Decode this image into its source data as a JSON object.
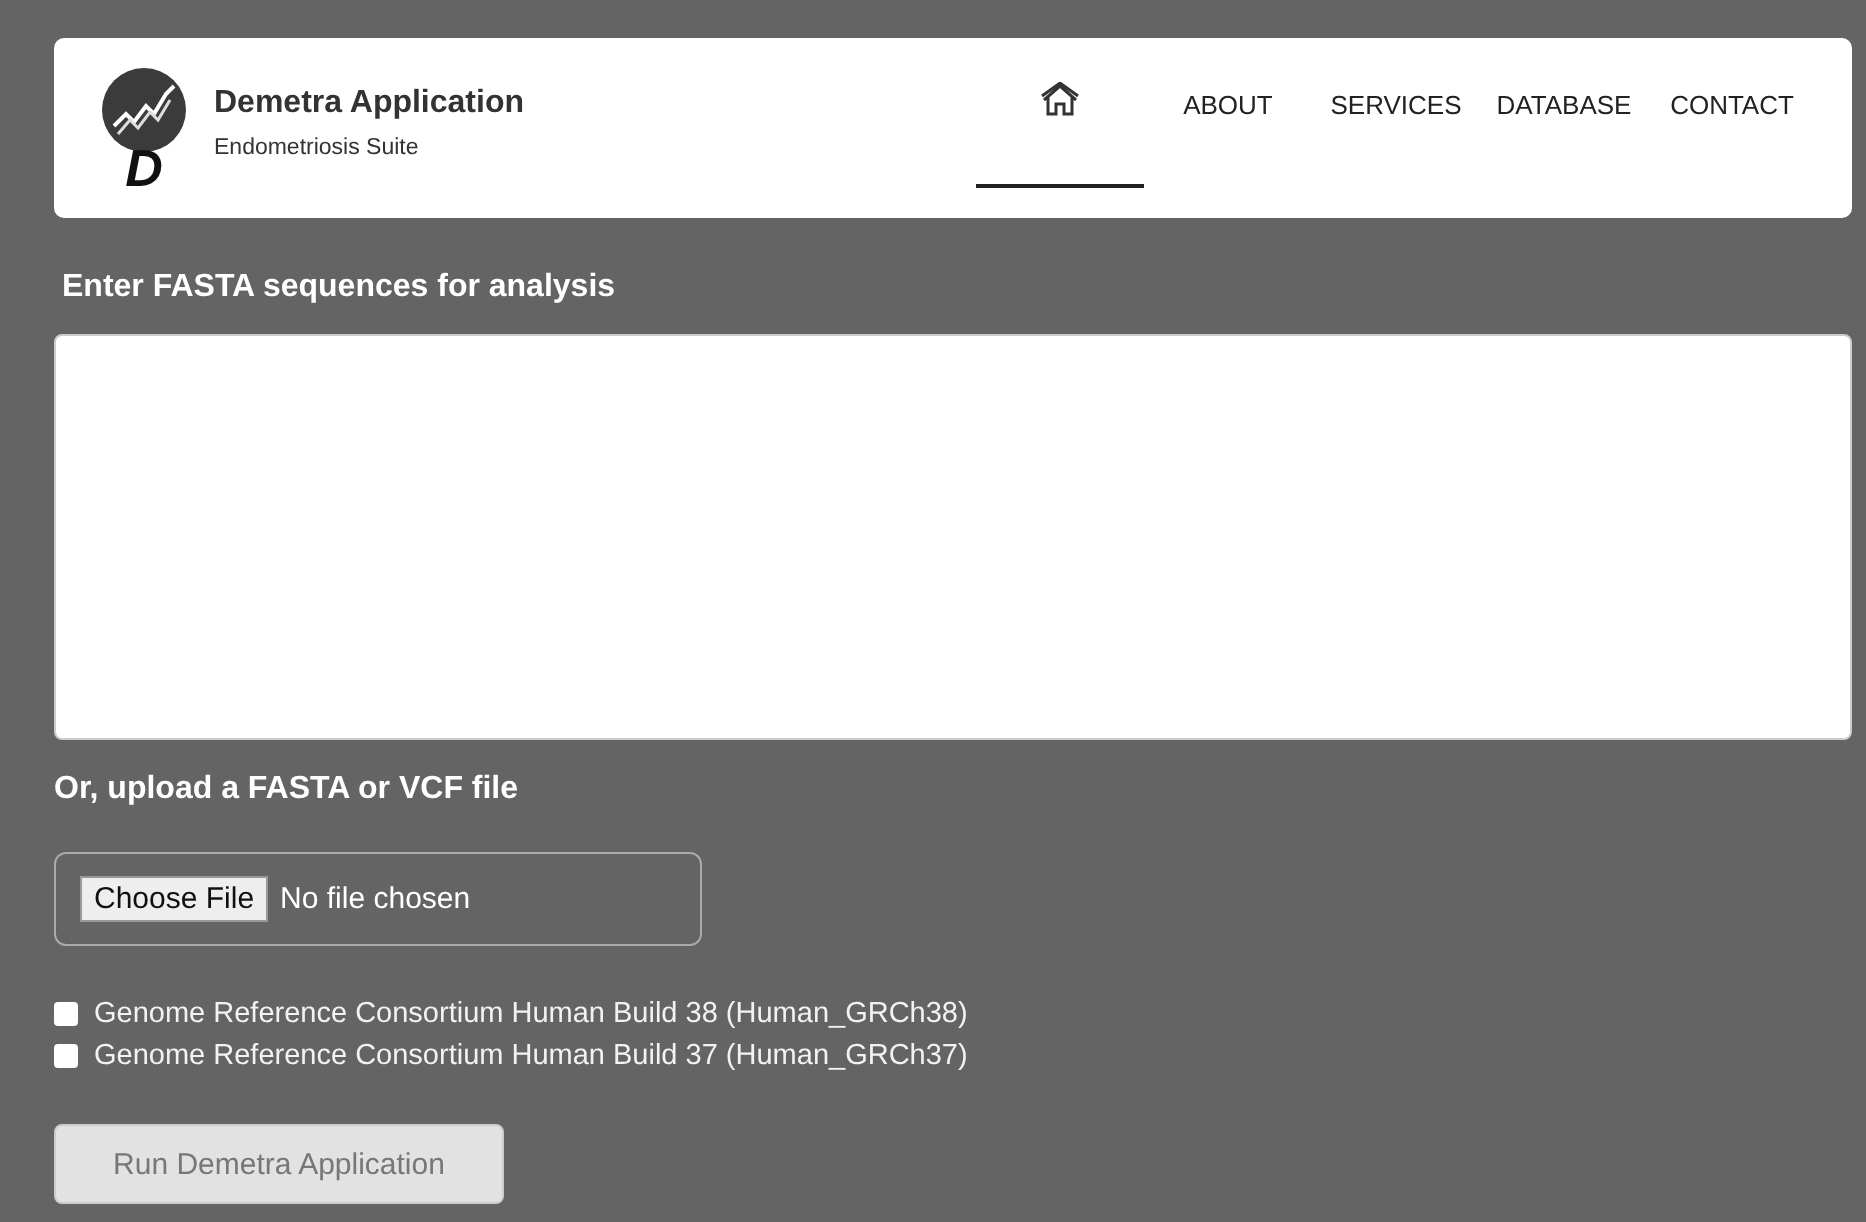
{
  "header": {
    "logo": {
      "letter": "D"
    },
    "title": "Demetra Application",
    "subtitle": "Endometriosis Suite"
  },
  "nav": [
    {
      "kind": "home",
      "selected": true
    },
    {
      "kind": "link",
      "label": "ABOUT",
      "selected": false
    },
    {
      "kind": "link",
      "label": "SERVICES",
      "selected": false
    },
    {
      "kind": "link",
      "label": "DATABASE",
      "selected": false
    },
    {
      "kind": "link",
      "label": "CONTACT",
      "selected": false
    }
  ],
  "sequence_label": "Enter FASTA sequences for analysis",
  "upload_label": "Or, upload a FASTA or VCF file",
  "file_input": {
    "button": "Choose File",
    "status": "No file chosen"
  },
  "options": [
    {
      "label": "Genome Reference Consortium Human Build 38 (Human_GRCh38)",
      "checked": false
    },
    {
      "label": "Genome Reference Consortium Human Build 37 (Human_GRCh37)",
      "checked": false
    }
  ],
  "run_button": "Run Demetra Application"
}
